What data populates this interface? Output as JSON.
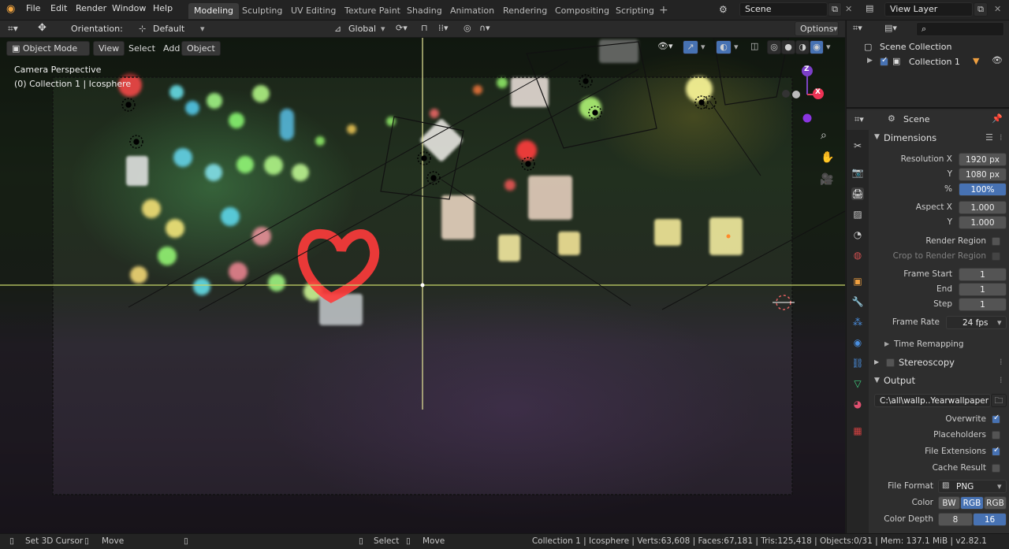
{
  "menu": [
    "File",
    "Edit",
    "Render",
    "Window",
    "Help"
  ],
  "workspaces": [
    "Modeling",
    "Sculpting",
    "UV Editing",
    "Texture Paint",
    "Shading",
    "Animation",
    "Rendering",
    "Compositing",
    "Scripting"
  ],
  "active_workspace": "Modeling",
  "scene_name": "Scene",
  "view_layer": "View Layer",
  "header": {
    "orientation_label": "Orientation:",
    "orientation_value": "Default",
    "transform_space": "Global",
    "options": "Options"
  },
  "mode_bar": {
    "mode": "Object Mode",
    "view": "View",
    "select": "Select",
    "add": "Add",
    "object": "Object"
  },
  "viewport": {
    "camera_label": "Camera Perspective",
    "collection_label": "(0) Collection 1 | Icosphere",
    "gizmo_z": "Z",
    "gizmo_x": "X"
  },
  "outliner": {
    "root": "Scene Collection",
    "child": "Collection 1"
  },
  "properties": {
    "context": "Scene",
    "dimensions": {
      "title": "Dimensions",
      "resolution_x_label": "Resolution X",
      "resolution_x": "1920 px",
      "resolution_y_label": "Y",
      "resolution_y": "1080 px",
      "percent_label": "%",
      "percent": "100%",
      "aspect_x_label": "Aspect X",
      "aspect_x": "1.000",
      "aspect_y_label": "Y",
      "aspect_y": "1.000",
      "render_region": "Render Region",
      "crop_region": "Crop to Render Region",
      "frame_start_label": "Frame Start",
      "frame_start": "1",
      "end_label": "End",
      "end": "1",
      "step_label": "Step",
      "step": "1",
      "frame_rate_label": "Frame Rate",
      "frame_rate": "24 fps",
      "time_remapping": "Time Remapping"
    },
    "stereoscopy": "Stereoscopy",
    "output": {
      "title": "Output",
      "path": "C:\\all\\wallp..Yearwallpaper",
      "overwrite": "Overwrite",
      "placeholders": "Placeholders",
      "file_extensions": "File Extensions",
      "cache_result": "Cache Result",
      "file_format_label": "File Format",
      "file_format": "PNG",
      "color_label": "Color",
      "color_options": [
        "BW",
        "RGB",
        "RGB"
      ],
      "color_depth_label": "Color Depth",
      "color_depth_options": [
        "8",
        "16"
      ]
    }
  },
  "status": {
    "left1": "Set 3D Cursor",
    "left2": "Move",
    "mid1": "Select",
    "mid2": "Move",
    "stats": "Collection 1 | Icosphere | Verts:63,608 | Faces:67,181 | Tris:125,418 | Objects:0/31 | Mem: 137.1 MiB | v2.82.1"
  },
  "colors": {
    "accent": "#4772b3",
    "active_tab": "#3b3b3b"
  }
}
